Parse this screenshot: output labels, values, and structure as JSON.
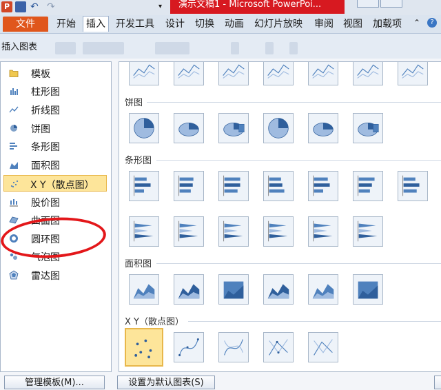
{
  "window": {
    "title": "演示文稿1 - Microsoft PowerPoi..."
  },
  "ribbon": {
    "file_tab": "文件",
    "tabs": [
      "开始",
      "插入",
      "开发工具",
      "设计",
      "切换",
      "动画",
      "幻灯片放映",
      "审阅",
      "视图",
      "加载项"
    ],
    "active_tab": "插入"
  },
  "dialog": {
    "title": "插入图表",
    "categories": [
      {
        "label": "模板",
        "icon": "folder-icon"
      },
      {
        "label": "柱形图",
        "icon": "column-chart-icon"
      },
      {
        "label": "折线图",
        "icon": "line-chart-icon"
      },
      {
        "label": "饼图",
        "icon": "pie-chart-icon"
      },
      {
        "label": "条形图",
        "icon": "bar-chart-icon"
      },
      {
        "label": "面积图",
        "icon": "area-chart-icon"
      },
      {
        "label": "X Y（散点图）",
        "icon": "scatter-chart-icon"
      },
      {
        "label": "股价图",
        "icon": "stock-chart-icon"
      },
      {
        "label": "曲面图",
        "icon": "surface-chart-icon"
      },
      {
        "label": "圆环图",
        "icon": "doughnut-chart-icon"
      },
      {
        "label": "气泡图",
        "icon": "bubble-chart-icon"
      },
      {
        "label": "雷达图",
        "icon": "radar-chart-icon"
      }
    ],
    "selected_category": "X Y（散点图）",
    "sections": {
      "pie": "饼图",
      "bar": "条形图",
      "area": "面积图",
      "scatter": "X Y（散点图）"
    },
    "buttons": {
      "manage_templates": "管理模板(M)...",
      "set_default": "设置为默认图表(S)"
    }
  },
  "colors": {
    "file_tab": "#e0561c",
    "title_highlight": "#d71920",
    "selection": "#fde59a",
    "annotation_circle": "#e3171a",
    "chart_blue": "#4f81bd"
  }
}
